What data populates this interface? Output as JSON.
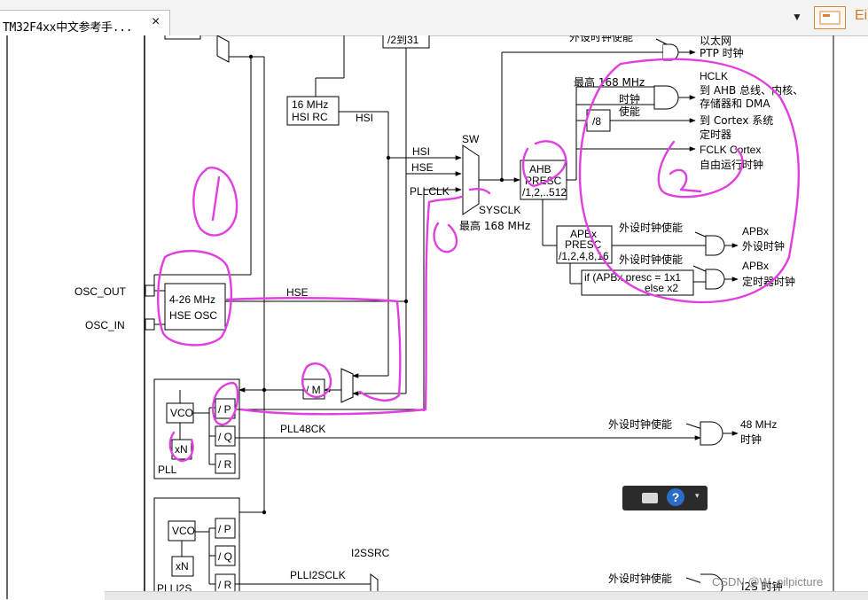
{
  "tab": {
    "title": "TM32F4xx中文参考手...",
    "close": "×"
  },
  "toolbar": {
    "menu": "▼",
    "extra": "Ei"
  },
  "labels": {
    "top_div": "/2到31",
    "hsi_rc_1": "16 MHz",
    "hsi_rc_2": "HSI RC",
    "hsi": "HSI",
    "hsi_in": "HSI",
    "hse_in": "HSE",
    "pllclk": "PLLCLK",
    "sw": "SW",
    "sysclk": "SYSCLK",
    "sysclk_max": "最高 168 MHz",
    "ahb_1": "AHB",
    "ahb_2": "PRESC",
    "ahb_3": "/1,2,..512",
    "apb_1": "APBx",
    "apb_2": "PRESC",
    "apb_3": "/1,2,4,8,16",
    "div8": "/8",
    "hclk_max": "最高 168 MHz",
    "clk_en_1": "时钟",
    "clk_en_2": "使能",
    "eth_en": "外设时钟使能",
    "eth_1": "以太网",
    "eth_2": "PTP 时钟",
    "hclk": "HCLK",
    "hclk_desc_1": "到 AHB 总线、内核、",
    "hclk_desc_2": "存储器和 DMA",
    "cortex_timer_1": "到 Cortex 系统",
    "cortex_timer_2": "定时器",
    "fclk_1": "FCLK Cortex",
    "fclk_2": "自由运行时钟",
    "apb_en_1": "外设时钟使能",
    "apb_out_1a": "APBx",
    "apb_out_1b": "外设时钟",
    "apb_en_2": "外设时钟使能",
    "timer_mul_1": "if (APBx presc = 1x1",
    "timer_mul_2": "else x2",
    "apb_out_2a": "APBx",
    "apb_out_2b": "定时器时钟",
    "osc_out": "OSC_OUT",
    "osc_in": "OSC_IN",
    "hse_osc_1": "4-26 MHz",
    "hse_osc_2": "HSE OSC",
    "hse": "HSE",
    "div_m": "/ M",
    "vco": "VCO",
    "xn": "xN",
    "div_p": "/ P",
    "div_q": "/ Q",
    "div_r": "/ R",
    "pll": "PLL",
    "pll48ck": "PLL48CK",
    "usb_en": "外设时钟使能",
    "usb_1": "48 MHz",
    "usb_2": "时钟",
    "vco2": "VCO",
    "xn2": "xN",
    "div_p2": "/ P",
    "div_q2": "/ Q",
    "div_r2": "/ R",
    "plli2s": "PLLI2S",
    "plli2sclk": "PLLI2SCLK",
    "i2ssrc": "I2SSRC",
    "i2s_en": "外设时钟使能",
    "i2s_clk": "I2S 时钟"
  },
  "help": {
    "icon": "?",
    "dropdown": "▾"
  },
  "watermark": "CSDN @W_oilpicture",
  "colors": {
    "annotation": "#e040e0",
    "wire": "#000000"
  }
}
